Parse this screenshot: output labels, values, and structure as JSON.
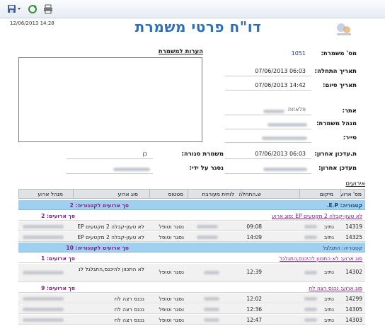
{
  "toolbar": {
    "save_icon": "save-disk-icon",
    "refresh_icon": "refresh-icon",
    "print_icon": "print-icon"
  },
  "timestamp": "12/06/2013 14:28",
  "title": "דו\"ח פרטי משמרת",
  "notes": {
    "label": "הערות למשמרת"
  },
  "fields": {
    "shift_no_label": "מס' משמרת:",
    "shift_no": "1051",
    "start_label": "תאריך התחלה:",
    "start": "06:03 07/06/2013",
    "end_label": "תאריך סיום:",
    "end": "14:42 07/06/2013",
    "site_label": "אתר:",
    "site": "פלאזות",
    "manager_label": "מנהל משמרת:",
    "patrol_label": "סייר:",
    "last_update_label": "ת.עדכון אחרון:",
    "last_update": "06:03 07/06/2013",
    "last_updater_label": "מעדכן אחרון:",
    "closed_label": "משמרת סגורה:",
    "closed": "כן",
    "closed_by_label": "נסגר על ידי:"
  },
  "events": {
    "label": "אירועים",
    "columns": [
      "מס' ארוע",
      "מיקום",
      "ש.התחלה",
      "לוחית מעורבת",
      "סטטוס",
      "סוג ארוע",
      "מנהל ארוע"
    ],
    "rows": [
      {
        "kind": "category",
        "title": "קטגוריה: E.P.",
        "summary": "סך ארועים לקטגוריה: 2"
      },
      {
        "kind": "subtype",
        "title": "לא טעון-קבלה 2 מקטעים EP :סוג ארוע",
        "summary": "סך ארועים: 2"
      },
      {
        "kind": "data",
        "id": "14319",
        "location": "נתיב",
        "start": "09:08",
        "status": "נסגר וטופל",
        "type": "לא טעון-קבלה 2 מקטעים EP"
      },
      {
        "kind": "data",
        "id": "14325",
        "location": "נתיב",
        "start": "14:09",
        "status": "נסגר וטופל",
        "type": "לא טעון-קבלה 2 מקטעים EP"
      },
      {
        "kind": "category",
        "title": "קטגוריה: התגלגל",
        "summary": "סך ארועים לקטגוריה: 10"
      },
      {
        "kind": "subtype",
        "title": "סוג ארוע: לא התכוון להיכנס,התגלגל",
        "summary": "סך ארועים: 1"
      },
      {
        "kind": "data",
        "id": "14302",
        "location": "נתיב",
        "start": "12:39",
        "status": "נסגר וטופל",
        "type": "לא התכוון להיכנס,התגלגל לנ"
      },
      {
        "kind": "subtype",
        "title": "סוג ארוע: נכנס רצה לח",
        "summary": "סך ארועים: 9"
      },
      {
        "kind": "data",
        "id": "14299",
        "location": "נתיב",
        "start": "12:02",
        "status": "נסגר וטופל",
        "type": "נכנס רצה לח"
      },
      {
        "kind": "data",
        "id": "14305",
        "location": "נתיב",
        "start": "12:36",
        "status": "נסגר וטופל",
        "type": "נכנס רצה לח"
      },
      {
        "kind": "data",
        "id": "14303",
        "location": "נתיב",
        "start": "12:47",
        "status": "נסגר וטופל",
        "type": "נכנס רצה לח"
      }
    ]
  },
  "colors": {
    "title": "#2f6fb6",
    "category_row": "#9fd0f0",
    "link": "#8b1a8b",
    "value": "#1e3c78"
  }
}
